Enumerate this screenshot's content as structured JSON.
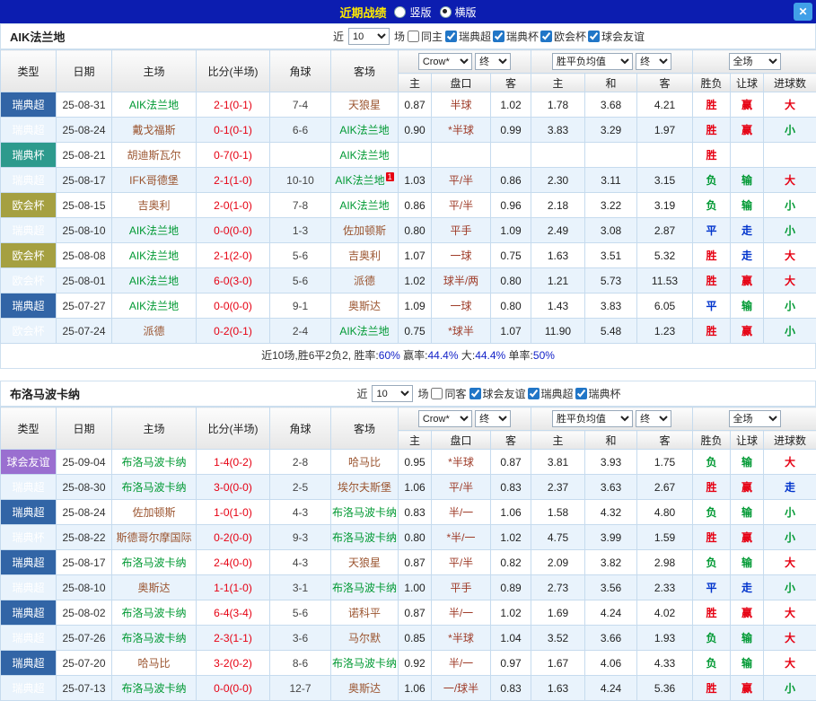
{
  "topbar": {
    "title": "近期战绩",
    "radios": [
      {
        "label": "竖版",
        "selected": false
      },
      {
        "label": "横版",
        "selected": true
      }
    ],
    "close_label": "✕"
  },
  "table_head": {
    "cols": [
      "类型",
      "日期",
      "主场",
      "比分(半场)",
      "角球",
      "客场"
    ],
    "subcols": [
      "主",
      "盘口",
      "客",
      "主",
      "和",
      "客",
      "胜负",
      "让球",
      "进球数"
    ]
  },
  "sections": [
    {
      "team": "AIK法兰地",
      "filter": {
        "near_label": "近",
        "near_value": "10",
        "games_label": "场",
        "same_label": "同主",
        "same_checked": false,
        "leagues": [
          {
            "label": "瑞典超",
            "checked": true
          },
          {
            "label": "瑞典杯",
            "checked": true
          },
          {
            "label": "欧会杯",
            "checked": true
          },
          {
            "label": "球会友谊",
            "checked": true
          }
        ]
      },
      "selectors": {
        "odds_company": "Crow*",
        "final1": "终",
        "avg": "胜平负均值",
        "final2": "终",
        "scope": "全场"
      },
      "rows": [
        {
          "type": "瑞典超",
          "tk": "sc",
          "date": "25-08-31",
          "home": "AIK法兰地",
          "hh": true,
          "score": "2-1(0-1)",
          "corner": "7-4",
          "away": "天狼星",
          "ah": false,
          "o1": "0.87",
          "hc": "半球",
          "o2": "1.02",
          "a1": "1.78",
          "a2": "3.68",
          "a3": "4.21",
          "r1": "胜",
          "r2": "赢",
          "r3": "大"
        },
        {
          "type": "瑞典超",
          "tk": "sc",
          "date": "25-08-24",
          "home": "戴戈福斯",
          "hh": false,
          "score": "0-1(0-1)",
          "corner": "6-6",
          "away": "AIK法兰地",
          "ah": true,
          "o1": "0.90",
          "hc": "*半球",
          "o2": "0.99",
          "a1": "3.83",
          "a2": "3.29",
          "a3": "1.97",
          "r1": "胜",
          "r2": "赢",
          "r3": "小"
        },
        {
          "type": "瑞典杯",
          "tk": "sb",
          "date": "25-08-21",
          "home": "胡迪斯瓦尔",
          "hh": false,
          "score": "0-7(0-1)",
          "corner": "",
          "away": "AIK法兰地",
          "ah": true,
          "o1": "",
          "hc": "",
          "o2": "",
          "a1": "",
          "a2": "",
          "a3": "",
          "r1": "胜",
          "r2": "",
          "r3": ""
        },
        {
          "type": "瑞典超",
          "tk": "sc",
          "date": "25-08-17",
          "home": "IFK哥德堡",
          "hh": false,
          "score": "2-1(1-0)",
          "corner": "10-10",
          "away": "AIK法兰地",
          "ah": true,
          "ab": "1",
          "o1": "1.03",
          "hc": "平/半",
          "o2": "0.86",
          "a1": "2.30",
          "a2": "3.11",
          "a3": "3.15",
          "r1": "负",
          "r2": "输",
          "r3": "大"
        },
        {
          "type": "欧会杯",
          "tk": "ec",
          "date": "25-08-15",
          "home": "吉奥利",
          "hh": false,
          "score": "2-0(1-0)",
          "corner": "7-8",
          "away": "AIK法兰地",
          "ah": true,
          "o1": "0.86",
          "hc": "平/半",
          "o2": "0.96",
          "a1": "2.18",
          "a2": "3.22",
          "a3": "3.19",
          "r1": "负",
          "r2": "输",
          "r3": "小"
        },
        {
          "type": "瑞典超",
          "tk": "sc",
          "date": "25-08-10",
          "home": "AIK法兰地",
          "hh": true,
          "score": "0-0(0-0)",
          "corner": "1-3",
          "away": "佐加顿斯",
          "ah": false,
          "o1": "0.80",
          "hc": "平手",
          "o2": "1.09",
          "a1": "2.49",
          "a2": "3.08",
          "a3": "2.87",
          "r1": "平",
          "r2": "走",
          "r3": "小"
        },
        {
          "type": "欧会杯",
          "tk": "ec",
          "date": "25-08-08",
          "home": "AIK法兰地",
          "hh": true,
          "score": "2-1(2-0)",
          "corner": "5-6",
          "away": "吉奥利",
          "ah": false,
          "o1": "1.07",
          "hc": "一球",
          "o2": "0.75",
          "a1": "1.63",
          "a2": "3.51",
          "a3": "5.32",
          "r1": "胜",
          "r2": "走",
          "r3": "大"
        },
        {
          "type": "欧会杯",
          "tk": "ec",
          "date": "25-08-01",
          "home": "AIK法兰地",
          "hh": true,
          "score": "6-0(3-0)",
          "corner": "5-6",
          "away": "派德",
          "ah": false,
          "o1": "1.02",
          "hc": "球半/两",
          "o2": "0.80",
          "a1": "1.21",
          "a2": "5.73",
          "a3": "11.53",
          "r1": "胜",
          "r2": "赢",
          "r3": "大"
        },
        {
          "type": "瑞典超",
          "tk": "sc",
          "date": "25-07-27",
          "home": "AIK法兰地",
          "hh": true,
          "score": "0-0(0-0)",
          "corner": "9-1",
          "away": "奥斯达",
          "ah": false,
          "o1": "1.09",
          "hc": "一球",
          "o2": "0.80",
          "a1": "1.43",
          "a2": "3.83",
          "a3": "6.05",
          "r1": "平",
          "r2": "输",
          "r3": "小"
        },
        {
          "type": "欧会杯",
          "tk": "ec",
          "date": "25-07-24",
          "home": "派德",
          "hh": false,
          "score": "0-2(0-1)",
          "corner": "2-4",
          "away": "AIK法兰地",
          "ah": true,
          "o1": "0.75",
          "hc": "*球半",
          "o2": "1.07",
          "a1": "11.90",
          "a2": "5.48",
          "a3": "1.23",
          "r1": "胜",
          "r2": "赢",
          "r3": "小"
        }
      ],
      "summary": [
        {
          "t": "近10场,胜6平2负2, 胜率:",
          "c": "k"
        },
        {
          "t": "60%",
          "c": "b"
        },
        {
          "t": " 赢率:",
          "c": "k"
        },
        {
          "t": "44.4%",
          "c": "b"
        },
        {
          "t": " 大:",
          "c": "k"
        },
        {
          "t": "44.4%",
          "c": "b"
        },
        {
          "t": " 单率:",
          "c": "k"
        },
        {
          "t": "50%",
          "c": "b"
        }
      ]
    },
    {
      "team": "布洛马波卡纳",
      "filter": {
        "near_label": "近",
        "near_value": "10",
        "games_label": "场",
        "same_label": "同客",
        "same_checked": false,
        "leagues": [
          {
            "label": "球会友谊",
            "checked": true
          },
          {
            "label": "瑞典超",
            "checked": true
          },
          {
            "label": "瑞典杯",
            "checked": true
          }
        ]
      },
      "selectors": {
        "odds_company": "Crow*",
        "final1": "终",
        "avg": "胜平负均值",
        "final2": "终",
        "scope": "全场"
      },
      "rows": [
        {
          "type": "球会友谊",
          "tk": "fr",
          "date": "25-09-04",
          "home": "布洛马波卡纳",
          "hh": true,
          "score": "1-4(0-2)",
          "corner": "2-8",
          "away": "哈马比",
          "ah": false,
          "o1": "0.95",
          "hc": "*半球",
          "o2": "0.87",
          "a1": "3.81",
          "a2": "3.93",
          "a3": "1.75",
          "r1": "负",
          "r2": "输",
          "r3": "大"
        },
        {
          "type": "瑞典超",
          "tk": "sc",
          "date": "25-08-30",
          "home": "布洛马波卡纳",
          "hh": true,
          "score": "3-0(0-0)",
          "corner": "2-5",
          "away": "埃尔夫斯堡",
          "ah": false,
          "o1": "1.06",
          "hc": "平/半",
          "o2": "0.83",
          "a1": "2.37",
          "a2": "3.63",
          "a3": "2.67",
          "r1": "胜",
          "r2": "赢",
          "r3": "走"
        },
        {
          "type": "瑞典超",
          "tk": "sc",
          "date": "25-08-24",
          "home": "佐加顿斯",
          "hh": false,
          "score": "1-0(1-0)",
          "corner": "4-3",
          "away": "布洛马波卡纳",
          "ah": true,
          "o1": "0.83",
          "hc": "半/一",
          "o2": "1.06",
          "a1": "1.58",
          "a2": "4.32",
          "a3": "4.80",
          "r1": "负",
          "r2": "输",
          "r3": "小"
        },
        {
          "type": "瑞典杯",
          "tk": "sb",
          "date": "25-08-22",
          "home": "斯德哥尔摩国际",
          "hh": false,
          "score": "0-2(0-0)",
          "corner": "9-3",
          "away": "布洛马波卡纳",
          "ah": true,
          "o1": "0.80",
          "hc": "*半/一",
          "o2": "1.02",
          "a1": "4.75",
          "a2": "3.99",
          "a3": "1.59",
          "r1": "胜",
          "r2": "赢",
          "r3": "小"
        },
        {
          "type": "瑞典超",
          "tk": "sc",
          "date": "25-08-17",
          "home": "布洛马波卡纳",
          "hh": true,
          "score": "2-4(0-0)",
          "corner": "4-3",
          "away": "天狼星",
          "ah": false,
          "o1": "0.87",
          "hc": "平/半",
          "o2": "0.82",
          "a1": "2.09",
          "a2": "3.82",
          "a3": "2.98",
          "r1": "负",
          "r2": "输",
          "r3": "大"
        },
        {
          "type": "瑞典超",
          "tk": "sc",
          "date": "25-08-10",
          "home": "奥斯达",
          "hh": false,
          "score": "1-1(1-0)",
          "corner": "3-1",
          "away": "布洛马波卡纳",
          "ah": true,
          "o1": "1.00",
          "hc": "平手",
          "o2": "0.89",
          "a1": "2.73",
          "a2": "3.56",
          "a3": "2.33",
          "r1": "平",
          "r2": "走",
          "r3": "小"
        },
        {
          "type": "瑞典超",
          "tk": "sc",
          "date": "25-08-02",
          "home": "布洛马波卡纳",
          "hh": true,
          "score": "6-4(3-4)",
          "corner": "5-6",
          "away": "诺科平",
          "ah": false,
          "o1": "0.87",
          "hc": "半/一",
          "o2": "1.02",
          "a1": "1.69",
          "a2": "4.24",
          "a3": "4.02",
          "r1": "胜",
          "r2": "赢",
          "r3": "大"
        },
        {
          "type": "瑞典超",
          "tk": "sc",
          "date": "25-07-26",
          "home": "布洛马波卡纳",
          "hh": true,
          "score": "2-3(1-1)",
          "corner": "3-6",
          "away": "马尔默",
          "ah": false,
          "o1": "0.85",
          "hc": "*半球",
          "o2": "1.04",
          "a1": "3.52",
          "a2": "3.66",
          "a3": "1.93",
          "r1": "负",
          "r2": "输",
          "r3": "大"
        },
        {
          "type": "瑞典超",
          "tk": "sc",
          "date": "25-07-20",
          "home": "哈马比",
          "hh": false,
          "score": "3-2(0-2)",
          "corner": "8-6",
          "away": "布洛马波卡纳",
          "ah": true,
          "o1": "0.92",
          "hc": "半/一",
          "o2": "0.97",
          "a1": "1.67",
          "a2": "4.06",
          "a3": "4.33",
          "r1": "负",
          "r2": "输",
          "r3": "大"
        },
        {
          "type": "瑞典超",
          "tk": "sc",
          "date": "25-07-13",
          "home": "布洛马波卡纳",
          "hh": true,
          "score": "0-0(0-0)",
          "corner": "12-7",
          "away": "奥斯达",
          "ah": false,
          "o1": "1.06",
          "hc": "一/球半",
          "o2": "0.83",
          "a1": "1.63",
          "a2": "4.24",
          "a3": "5.36",
          "r1": "胜",
          "r2": "赢",
          "r3": "小"
        }
      ]
    }
  ]
}
